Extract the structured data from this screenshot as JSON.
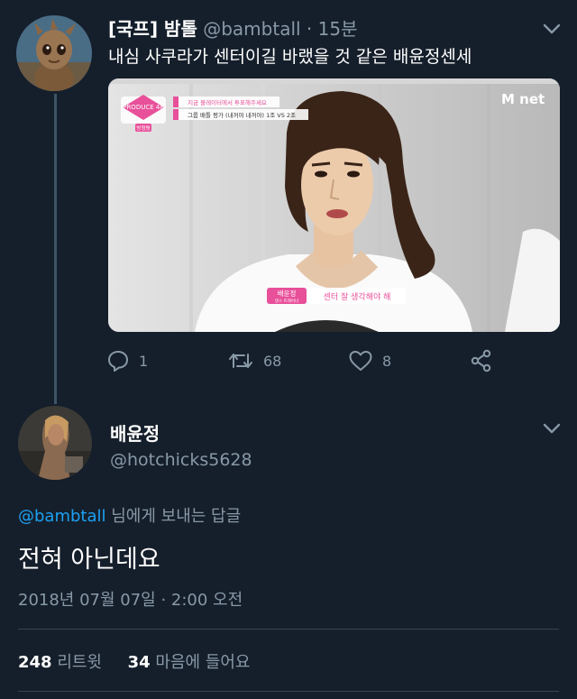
{
  "tweet": {
    "author_name": "[국프] 밤톨",
    "author_handle": "@bambtall",
    "separator": "·",
    "time_ago": "15분",
    "text": "내심 사쿠라가 센터이길 바랬을 것 같은 배윤정센세",
    "media": {
      "show_logo": "PRODUCE 48",
      "broadcaster_logo": "M net",
      "caption_top_1": "지금 볼레이터에서 투표해주세요",
      "caption_top_2": "그룹 배틀 평가 (내꺼야 내꺼야) 1조 VS 2조",
      "caption_small": "방청평",
      "name_tag": "배윤정",
      "name_sub": "댄스 트레이너",
      "subtitle": "센터 잘 생각해야 해"
    },
    "actions": {
      "reply_count": "1",
      "retweet_count": "68",
      "like_count": "8"
    }
  },
  "reply": {
    "author_name": "배윤정",
    "author_handle": "@hotchicks5628",
    "replying_to_mention": "@bambtall",
    "replying_to_suffix": " 님에게 보내는 답글",
    "text": "전혀 아닌데요",
    "timestamp": "2018년 07월 07일 · 2:00 오전",
    "retweet_count": "248",
    "retweet_label": "리트윗",
    "like_count": "34",
    "like_label": "마음에 들어요"
  },
  "icons": {
    "more": "chevron-down-icon",
    "reply": "comment-icon",
    "retweet": "retweet-icon",
    "like": "heart-icon",
    "share": "share-icon"
  },
  "colors": {
    "background": "#151f2b",
    "text_primary": "#ffffff",
    "text_secondary": "#8899a6",
    "mention": "#1da1f2",
    "thread_line": "#3d5466",
    "divider": "#38444d",
    "produce_pink": "#e8509a"
  }
}
